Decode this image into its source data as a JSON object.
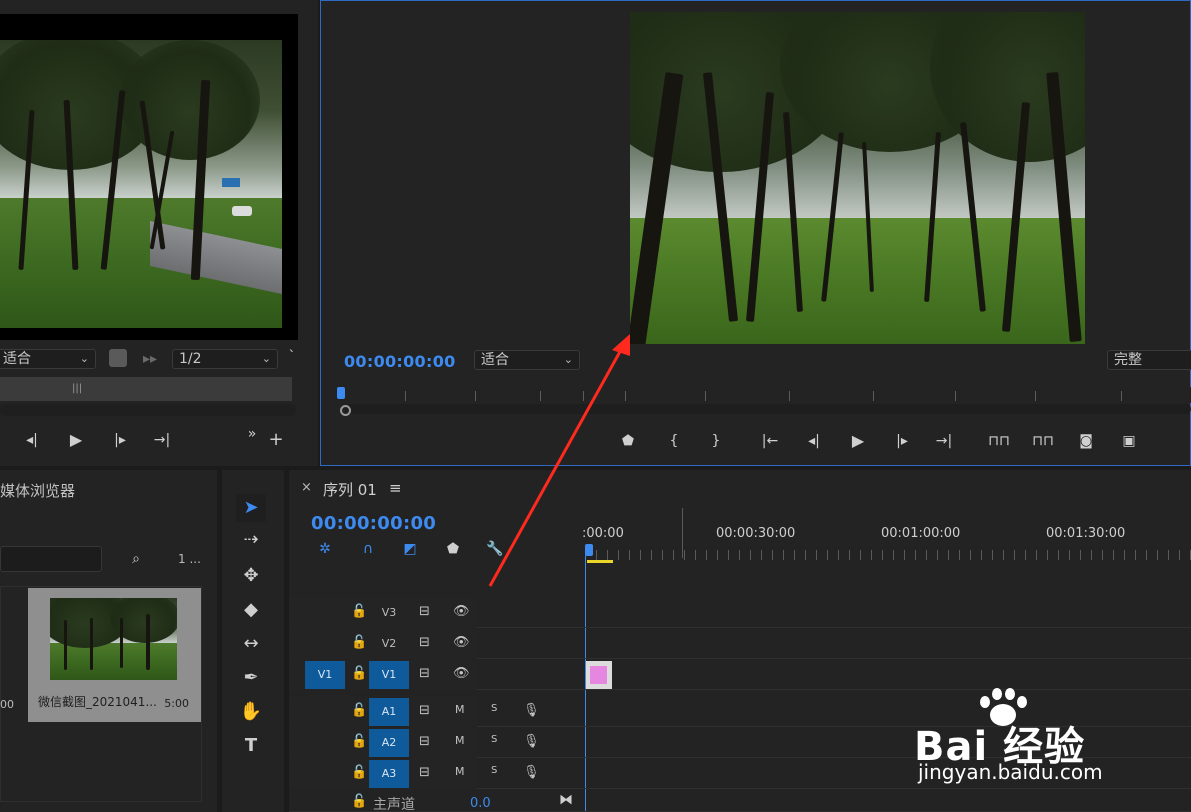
{
  "source": {
    "fit_label": "适合",
    "resolution_label": "1/2",
    "transport": [
      "step-back-icon",
      "play-icon",
      "step-forward-icon",
      "go-to-out-icon"
    ]
  },
  "program": {
    "timecode": "00:00:00:00",
    "fit_label": "适合",
    "quality_label": "完整"
  },
  "media_browser": {
    "title": "媒体浏览器",
    "count_label": "1 ...",
    "left_duration": "00",
    "clip": {
      "caption": "微信截图_2021041...",
      "duration": "5:00"
    }
  },
  "timeline": {
    "close": "×",
    "title": "序列 01",
    "menu": "≡",
    "timecode": "00:00:00:00",
    "ruler": [
      ":00:00",
      "00:00:30:00",
      "00:01:00:00",
      "00:01:30:00"
    ],
    "video_tracks": [
      {
        "name": "V3",
        "source": ""
      },
      {
        "name": "V2",
        "source": ""
      },
      {
        "name": "V1",
        "source": "V1"
      }
    ],
    "audio_tracks": [
      {
        "name": "A1",
        "m": "M",
        "s": "S"
      },
      {
        "name": "A2",
        "m": "M",
        "s": "S"
      },
      {
        "name": "A3",
        "m": "M",
        "s": "S"
      }
    ],
    "master": {
      "label": "主声道",
      "value": "0.0"
    }
  },
  "watermark": {
    "brand": "Bai 经验",
    "url": "jingyan.baidu.com"
  },
  "colors": {
    "accent": "#3d8bf0",
    "arrow": "#ff2a1e",
    "clip": "#e586e0"
  }
}
